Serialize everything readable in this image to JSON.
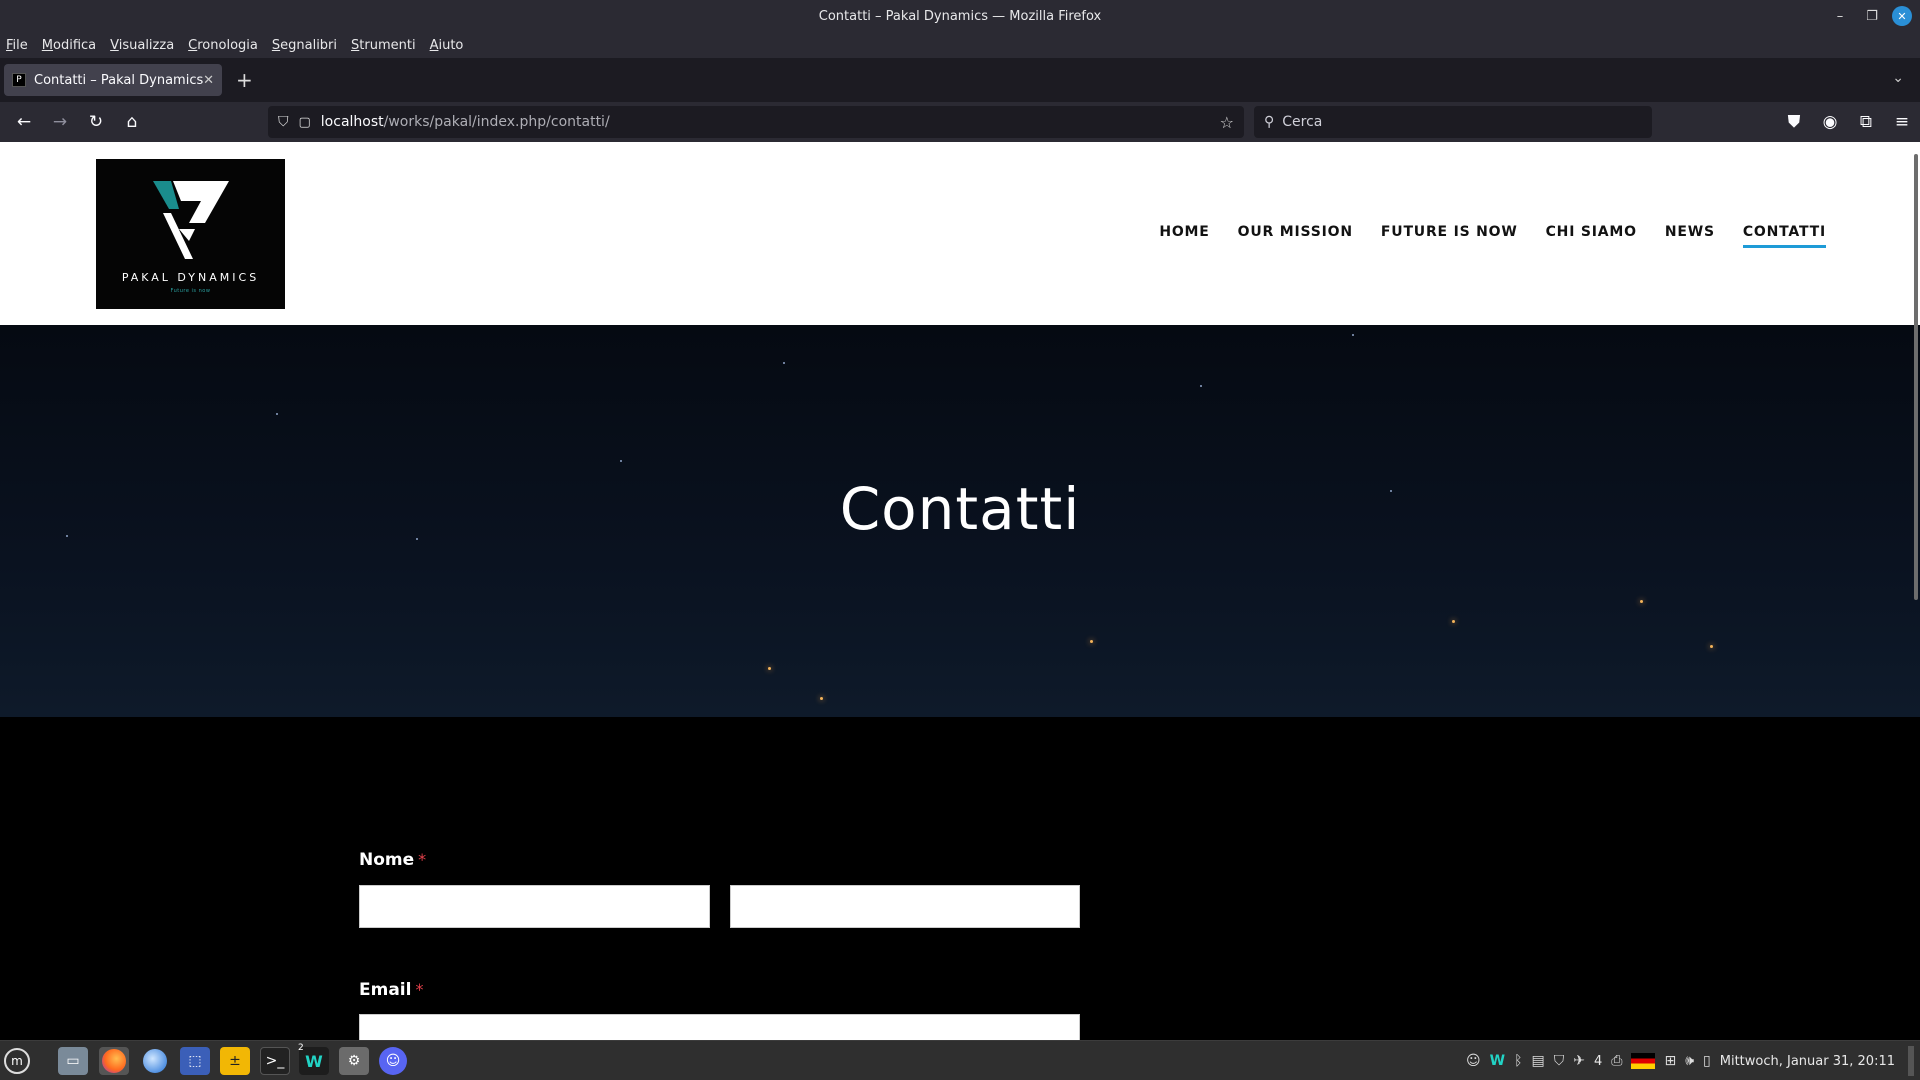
{
  "window": {
    "title": "Contatti – Pakal Dynamics — Mozilla Firefox"
  },
  "menubar": [
    "File",
    "Modifica",
    "Visualizza",
    "Cronologia",
    "Segnalibri",
    "Strumenti",
    "Aiuto"
  ],
  "tab": {
    "title": "Contatti – Pakal Dynamics"
  },
  "urlbar": {
    "host": "localhost",
    "path": "/works/pakal/index.php/contatti/"
  },
  "searchbar": {
    "placeholder": "Cerca"
  },
  "site": {
    "logo_name": "PAKAL DYNAMICS",
    "logo_tagline": "Future is now",
    "nav": [
      "HOME",
      "OUR MISSION",
      "FUTURE IS NOW",
      "CHI SIAMO",
      "NEWS",
      "CONTATTI"
    ],
    "active_nav": "CONTATTI",
    "hero_title": "Contatti",
    "form": {
      "name_label": "Nome",
      "email_label": "Email",
      "required_mark": "*"
    }
  },
  "taskbar": {
    "workspace_badge": "2",
    "notification_count": "4",
    "clock": "Mittwoch, Januar 31, 20:11"
  }
}
